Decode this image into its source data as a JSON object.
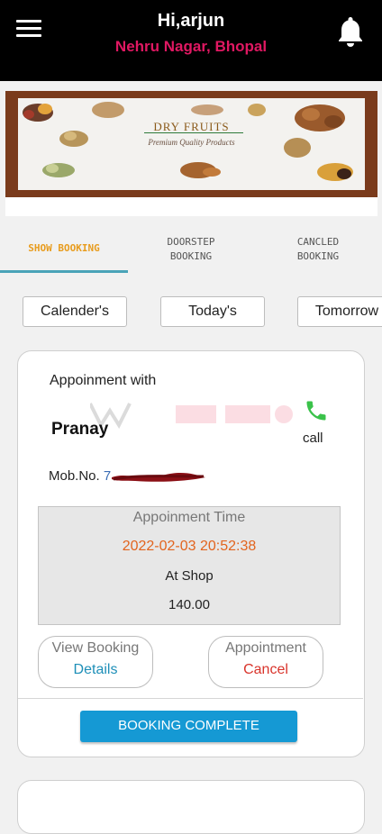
{
  "header": {
    "greeting": "Hi,arjun",
    "location": "Nehru Nagar, Bhopal",
    "location_color": "#e01862"
  },
  "banner": {
    "title": "DRY FRUITS",
    "subtitle": "Premium Quality Products"
  },
  "tabs": [
    {
      "line1": "SHOW BOOKING",
      "line2": "",
      "active": true
    },
    {
      "line1": "DOORSTEP",
      "line2": "BOOKING",
      "active": false
    },
    {
      "line1": "CANCLED",
      "line2": "BOOKING",
      "active": false
    }
  ],
  "filters": [
    "Calender's",
    "Today's",
    "Tomorrow"
  ],
  "booking": {
    "appointment_with_label": "Appoinment with",
    "customer_name": "Pranay",
    "call_label": "call",
    "mobile_label": "Mob.No.",
    "mobile_value": "7",
    "time_label": "Appoinment Time",
    "time_value": "2022-02-03 20:52:38",
    "place": "At Shop",
    "amount": "140.00",
    "view_booking": {
      "line1": "View Booking",
      "line2": "Details"
    },
    "cancel_appointment": {
      "line1": "Appointment",
      "line2": "Cancel"
    },
    "complete_label": "BOOKING COMPLETE"
  },
  "colors": {
    "accent_blue": "#1599d4",
    "time_orange": "#e2641e",
    "cancel_red": "#d9342b",
    "details_blue": "#1e8fb8",
    "tab_active": "#e89c1e",
    "call_green": "#3ac24a"
  }
}
